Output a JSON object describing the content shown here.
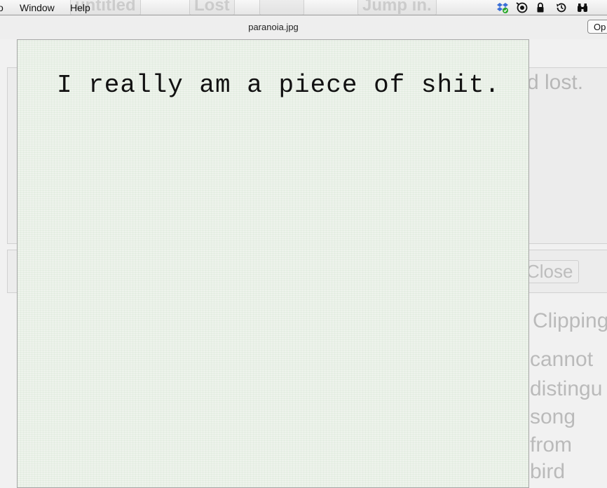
{
  "menubar": {
    "items": [
      "o",
      "Window",
      "Help"
    ],
    "background_tabs": [
      "untitled",
      "Lost",
      "",
      "Jump in."
    ],
    "status_icons": [
      "dropbox-icon",
      "target-icon",
      "lock-icon",
      "time-machine-icon",
      "binoculars-icon"
    ]
  },
  "window": {
    "title": "paranoia.jpg",
    "open_button_label": "Op"
  },
  "background_window": {
    "text_lines": [
      "d lost.",
      "Close",
      "Clipping",
      "cannot",
      "distingu",
      "song",
      "from",
      "bird"
    ]
  },
  "document": {
    "text": "I really am a piece of shit."
  }
}
